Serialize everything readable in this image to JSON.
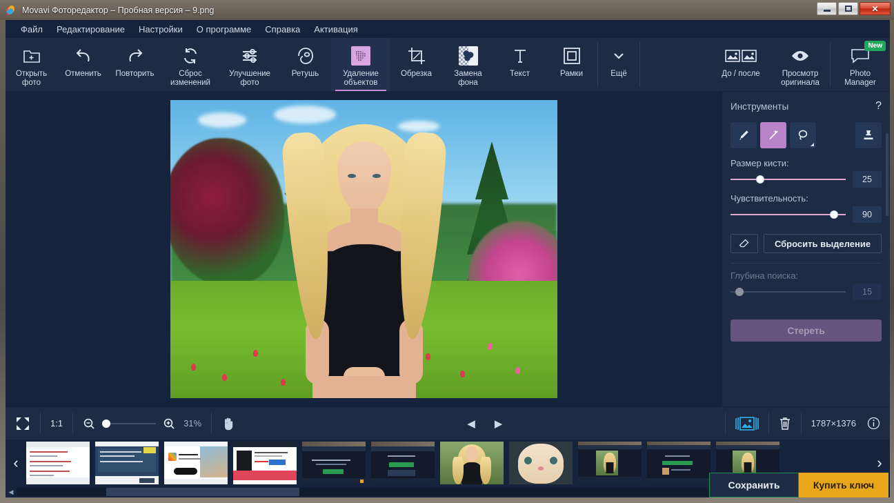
{
  "window": {
    "title": "Movavi Фоторедактор – Пробная версия – 9.png",
    "icon": "movavi-logo-icon",
    "minimize": "–",
    "maximize": "□",
    "close": "✕"
  },
  "menubar": {
    "items": [
      {
        "label": "Файл",
        "name": "menu-file"
      },
      {
        "label": "Редактирование",
        "name": "menu-edit"
      },
      {
        "label": "Настройки",
        "name": "menu-settings"
      },
      {
        "label": "О программе",
        "name": "menu-about"
      },
      {
        "label": "Справка",
        "name": "menu-help"
      },
      {
        "label": "Активация",
        "name": "menu-activation"
      }
    ]
  },
  "toolbar": {
    "items": [
      {
        "label": "Открыть\nфото",
        "icon": "folder-plus-icon",
        "active": false
      },
      {
        "label": "Отменить",
        "icon": "undo-icon",
        "active": false
      },
      {
        "label": "Повторить",
        "icon": "redo-icon",
        "active": false
      },
      {
        "label": "Сброс\nизменений",
        "icon": "reset-icon",
        "active": false
      },
      {
        "label": "Улучшение\nфото",
        "icon": "sliders-icon",
        "active": false
      },
      {
        "label": "Ретушь",
        "icon": "retouch-face-icon",
        "active": false
      },
      {
        "label": "Удаление\nобъектов",
        "icon": "object-removal-icon",
        "active": true
      },
      {
        "label": "Обрезка",
        "icon": "crop-icon",
        "active": false
      },
      {
        "label": "Замена\nфона",
        "icon": "background-change-icon",
        "active": false
      },
      {
        "label": "Текст",
        "icon": "text-icon",
        "active": false
      },
      {
        "label": "Рамки",
        "icon": "frames-icon",
        "active": false
      },
      {
        "label": "Ещё",
        "icon": "chevron-down-icon",
        "active": false
      }
    ],
    "right_items": [
      {
        "label": "До / после",
        "icon": "before-after-icon",
        "badge": ""
      },
      {
        "label": "Просмотр\nоригинала",
        "icon": "eye-icon",
        "badge": ""
      },
      {
        "label": "Photo\nManager",
        "icon": "photo-manager-icon",
        "badge": "New"
      }
    ]
  },
  "right_panel": {
    "title": "Инструменты",
    "help": "?",
    "tools": [
      {
        "name": "brush-tool",
        "icon": "brush-icon",
        "selected": false
      },
      {
        "name": "magic-wand-tool",
        "icon": "magic-wand-icon",
        "selected": true
      },
      {
        "name": "lasso-tool",
        "icon": "lasso-icon",
        "selected": false
      },
      {
        "name": "stamp-tool",
        "icon": "stamp-icon",
        "selected": false
      }
    ],
    "brush_size": {
      "label": "Размер кисти:",
      "value": "25",
      "percent": 22
    },
    "sensitivity": {
      "label": "Чувствительность:",
      "value": "90",
      "percent": 88
    },
    "eraser_icon": "eraser-icon",
    "reset_selection": "Сбросить выделение",
    "search_depth": {
      "label": "Глубина поиска:",
      "value": "15",
      "percent": 5,
      "disabled": true
    },
    "erase_button": "Стереть"
  },
  "bottom_bar": {
    "fit_icon": "fit-to-screen-icon",
    "one_to_one": "1:1",
    "zoom_out_icon": "zoom-out-icon",
    "zoom_in_icon": "zoom-in-icon",
    "zoom_value": "31%",
    "hand_icon": "hand-tool-icon",
    "prev_icon": "◀",
    "next_icon": "▶",
    "filmstrip_toggle_icon": "filmstrip-toggle-icon",
    "delete_icon": "trash-icon",
    "dimensions": "1787×1376",
    "info_icon": "info-icon"
  },
  "filmstrip": {
    "prev_arrow": "‹",
    "next_arrow": "›",
    "thumbnails": [
      {
        "name": "thumb-webpage-1",
        "kind": "web-light",
        "selected": false
      },
      {
        "name": "thumb-webpage-2",
        "kind": "web-dialog",
        "selected": false
      },
      {
        "name": "thumb-webpage-3",
        "kind": "web-hero",
        "selected": false
      },
      {
        "name": "thumb-webpage-4",
        "kind": "web-product",
        "selected": false
      },
      {
        "name": "thumb-app-1",
        "kind": "app-dark",
        "selected": false
      },
      {
        "name": "thumb-app-2",
        "kind": "app-dark2",
        "selected": false
      },
      {
        "name": "thumb-portrait-1",
        "kind": "portrait",
        "selected": true
      },
      {
        "name": "thumb-cat",
        "kind": "cat",
        "selected": false
      },
      {
        "name": "thumb-app-3",
        "kind": "app-portrait",
        "selected": false
      },
      {
        "name": "thumb-app-4",
        "kind": "app-dialog",
        "selected": false
      },
      {
        "name": "thumb-app-5",
        "kind": "app-portrait2",
        "selected": false
      }
    ]
  },
  "actions": {
    "save": "Сохранить",
    "buy_key": "Купить ключ"
  },
  "colors": {
    "accent_purple": "#c98fd6",
    "panel_bg": "#1d2b45",
    "canvas_bg": "#16233c",
    "menubar_bg": "#16233c",
    "badge_green": "#1fa85c",
    "buy_orange": "#e9a81b",
    "save_border_green": "#1e8e53",
    "slider_pink": "#e3a8d2",
    "select_blue": "#2bb3ef"
  }
}
